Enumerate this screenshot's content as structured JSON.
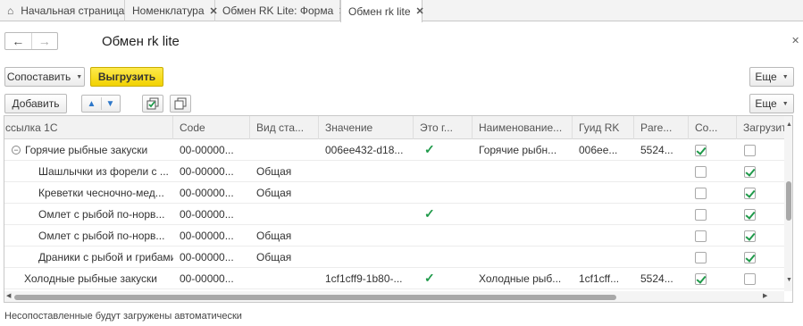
{
  "tabs": [
    {
      "label": "Начальная страница",
      "closable": false,
      "active": false,
      "icon": "home-icon"
    },
    {
      "label": "Номенклатура",
      "closable": true,
      "active": false
    },
    {
      "label": "Обмен RK Lite: Форма",
      "closable": true,
      "active": false
    },
    {
      "label": "Обмен rk lite",
      "closable": true,
      "active": true
    }
  ],
  "header": {
    "title": "Обмен rk lite",
    "back_icon": "arrow-left-icon",
    "forward_icon": "arrow-right-icon"
  },
  "toolbar1": {
    "compare_label": "Сопоставить",
    "upload_label": "Выгрузить",
    "more_label": "Еще"
  },
  "toolbar2": {
    "add_label": "Добавить",
    "more_label": "Еще"
  },
  "table": {
    "columns": [
      "ссылка 1С",
      "Code",
      "Вид ста...",
      "Значение",
      "Это г...",
      "Наименование...",
      "Гуид RK",
      "Pare...",
      "Со...",
      "Загрузит"
    ],
    "rows": [
      {
        "name": "Горячие рыбные закуски",
        "group": true,
        "code": "00-00000...",
        "vid": "",
        "value": "006ee432-d18...",
        "is_group": true,
        "naimen": "Горячие рыбн...",
        "guid": "006ee...",
        "parent": "5524...",
        "so": true,
        "load": false
      },
      {
        "name": "Шашлычки из форели с ...",
        "group": false,
        "code": "00-00000...",
        "vid": "Общая",
        "value": "",
        "is_group": false,
        "naimen": "",
        "guid": "",
        "parent": "",
        "so": false,
        "load": true
      },
      {
        "name": "Креветки чесночно-мед...",
        "group": false,
        "code": "00-00000...",
        "vid": "Общая",
        "value": "",
        "is_group": false,
        "naimen": "",
        "guid": "",
        "parent": "",
        "so": false,
        "load": true
      },
      {
        "name": "Омлет с рыбой по-норв...",
        "group": false,
        "code": "00-00000...",
        "vid": "",
        "value": "",
        "is_group": true,
        "naimen": "",
        "guid": "",
        "parent": "",
        "so": false,
        "load": true
      },
      {
        "name": "Омлет с рыбой по-норв...",
        "group": false,
        "code": "00-00000...",
        "vid": "Общая",
        "value": "",
        "is_group": false,
        "naimen": "",
        "guid": "",
        "parent": "",
        "so": false,
        "load": true
      },
      {
        "name": "Драники с рыбой и грибами",
        "group": false,
        "code": "00-00000...",
        "vid": "Общая",
        "value": "",
        "is_group": false,
        "naimen": "",
        "guid": "",
        "parent": "",
        "so": false,
        "load": true
      },
      {
        "name": "Холодные рыбные закуски",
        "group": false,
        "code": "00-00000...",
        "vid": "",
        "value": "1cf1cff9-1b80-...",
        "is_group": true,
        "naimen": "Холодные рыб...",
        "guid": "1cf1cff...",
        "parent": "5524...",
        "so": true,
        "load": false
      }
    ]
  },
  "footer_text": "Несопоставленные будут загружены автоматически",
  "colors": {
    "accent_yellow": "#f2d200",
    "check_green": "#1f9a4a",
    "arrow_blue": "#2d77c9"
  }
}
